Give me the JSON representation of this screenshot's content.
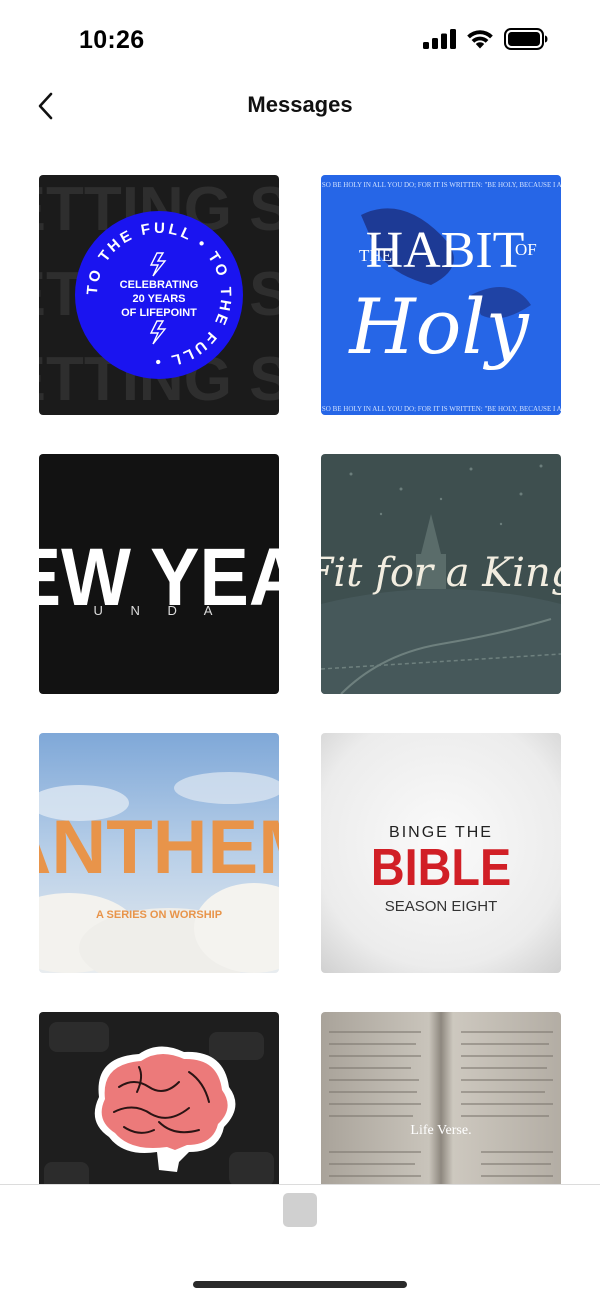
{
  "status_bar": {
    "time": "10:26",
    "icons": [
      "cellular-signal-icon",
      "wifi-icon",
      "battery-icon"
    ]
  },
  "nav": {
    "title": "Messages",
    "back_icon": "chevron-left-icon"
  },
  "messages": [
    {
      "id": "to-the-full",
      "ring_text": "TO THE FULL • TO THE FULL •",
      "center_text": [
        "CELEBRATING",
        "20 YEARS",
        "OF LIFEPOINT"
      ],
      "bg_text": "JUST GETTING STARTED",
      "accent": "#1a14f0"
    },
    {
      "id": "habit-of-holy",
      "top_text": "THE",
      "main_text": "HABIT",
      "small_text": "OF",
      "script_text": "Holy",
      "banner_text": "BE HOLY, SO BE HOLY IN ALL YOU DO; FOR IT IS WRITTEN: \"BE HOLY, BECAUSE I AM HOLY.\"",
      "accent": "#2a6ef0"
    },
    {
      "id": "new-year-sunday",
      "main_text": "EW YEA",
      "sub_text": "U N D A",
      "accent": "#111111"
    },
    {
      "id": "fit-for-a-king",
      "script_text": "Fit for a King",
      "accent": "#3e4f4f"
    },
    {
      "id": "anthem",
      "main_text": "ANTHEM",
      "sub_text": "A SERIES ON WORSHIP",
      "accent": "#e8944a"
    },
    {
      "id": "binge-the-bible",
      "line1": "BINGE THE",
      "line2": "BIBLE",
      "line3": "SEASON EIGHT",
      "accent": "#d11f26"
    },
    {
      "id": "brain",
      "accent": "#ec7a7a"
    },
    {
      "id": "life-verse",
      "logo_text": "Life Verse.",
      "accent": "#b8b2a8"
    }
  ],
  "bottom": {
    "home_indicator": true
  }
}
